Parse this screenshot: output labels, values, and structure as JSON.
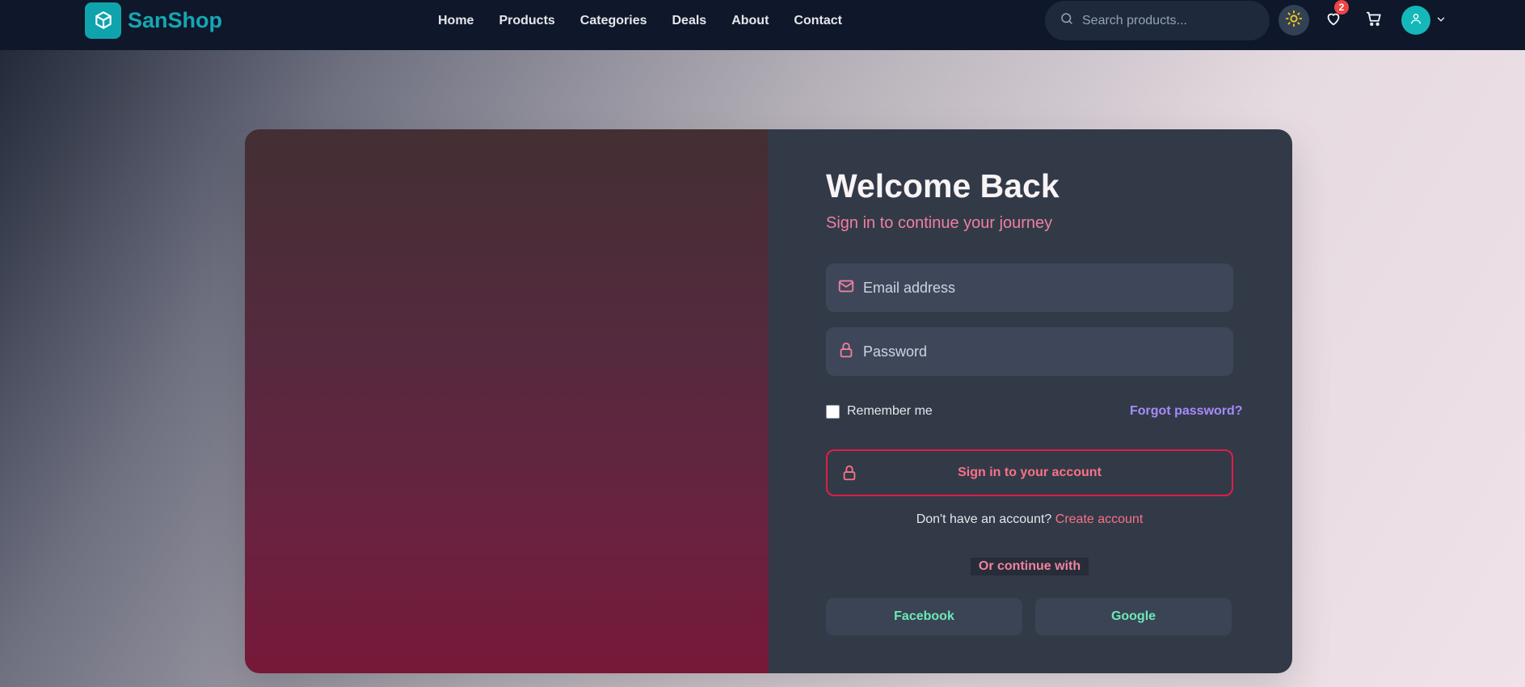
{
  "brand": {
    "name": "SanShop",
    "icon": "package-icon"
  },
  "nav": {
    "links": [
      "Home",
      "Products",
      "Categories",
      "Deals",
      "About",
      "Contact"
    ]
  },
  "search": {
    "placeholder": "Search products...",
    "value": ""
  },
  "header_actions": {
    "theme_icon": "sun-icon",
    "wishlist_icon": "heart-icon",
    "wishlist_count": "2",
    "cart_icon": "cart-icon",
    "avatar_icon": "user-icon"
  },
  "login": {
    "title": "Welcome Back",
    "subtitle": "Sign in to continue your journey",
    "email_placeholder": "Email address",
    "password_placeholder": "Password",
    "remember_label": "Remember me",
    "remember_checked": false,
    "forgot_label": "Forgot password?",
    "signin_label": "Sign in to your account",
    "no_account_text": "Don't have an account?",
    "create_account_label": "Create account",
    "divider_label": "Or continue with",
    "social": [
      "Facebook",
      "Google"
    ]
  },
  "colors": {
    "navbar_bg": "#0f172a",
    "brand_teal": "#0fa3ad",
    "accent_pink": "#fb7185",
    "accent_purple": "#a78bfa",
    "social_green": "#6ee7b7",
    "card_right_bg": "#323a48"
  }
}
